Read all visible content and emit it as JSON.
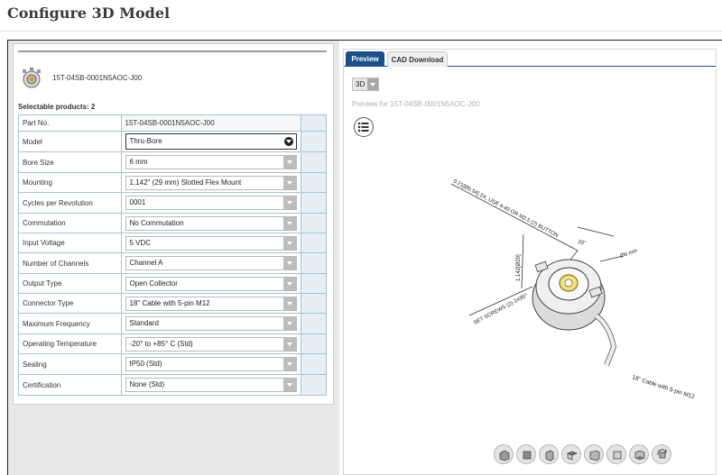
{
  "page": {
    "title": "Configure 3D Model"
  },
  "product": {
    "name": "15T-04SB-0001N5AOC-J00",
    "selectable_label": "Selectable products: 2"
  },
  "config": {
    "part_no": {
      "label": "Part No.",
      "value": "15T-04SB-0001N5AOC-J00"
    },
    "rows": [
      {
        "label": "Model",
        "value": "Thru-Bore"
      },
      {
        "label": "Bore Size",
        "value": "6 mm"
      },
      {
        "label": "Mounting",
        "value": "1.142\" (29 mm) Slotted Flex Mount"
      },
      {
        "label": "Cycles per Revolution",
        "value": "0001"
      },
      {
        "label": "Commutation",
        "value": "No Commutation"
      },
      {
        "label": "Input Voltage",
        "value": "5 VDC"
      },
      {
        "label": "Number of Channels",
        "value": "Channel A"
      },
      {
        "label": "Output Type",
        "value": "Open Collector"
      },
      {
        "label": "Connector Type",
        "value": "18\" Cable with 5-pin M12"
      },
      {
        "label": "Maximum Frequency",
        "value": "Standard"
      },
      {
        "label": "Operating Temperature",
        "value": "-20° to +85° C (Std)"
      },
      {
        "label": "Sealing",
        "value": "IP50 (Std)"
      },
      {
        "label": "Certification",
        "value": "None (Std)"
      }
    ]
  },
  "tabs": {
    "preview": "Preview",
    "cad": "CAD Download"
  },
  "viewer": {
    "view_mode": "3D",
    "preview_for": "Preview for 15T-04SB-0001N5AOC-J00",
    "annotations": {
      "screw": "0.21[Ø5.54] 2X, USE 4-40 OR M2.5 (2) BUTTON",
      "dim": "1.142[Ø29]",
      "angle": "20°",
      "setscrew": "SET SCREWS (2) 2X90°",
      "bore": "Ø6 mm",
      "cable": "18\" Cable with 5-pin M12"
    }
  },
  "toolbar": [
    "view-iso-icon",
    "view-front-icon",
    "view-left-icon",
    "view-top-icon",
    "view-right-icon",
    "view-back-icon",
    "view-bottom-icon",
    "rotate-icon"
  ]
}
